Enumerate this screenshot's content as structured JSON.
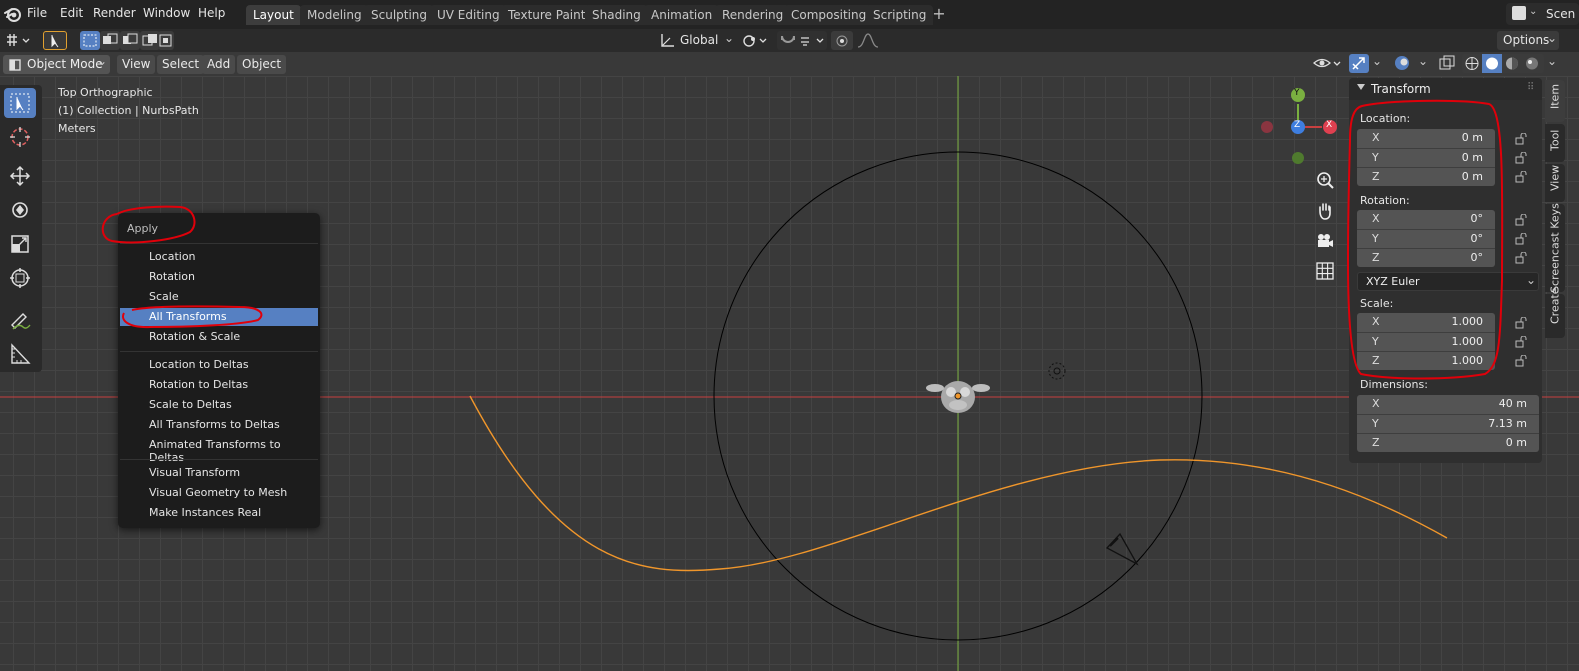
{
  "menubar": {
    "items": [
      "File",
      "Edit",
      "Render",
      "Window",
      "Help"
    ],
    "workspaces": [
      "Layout",
      "Modeling",
      "Sculpting",
      "UV Editing",
      "Texture Paint",
      "Shading",
      "Animation",
      "Rendering",
      "Compositing",
      "Scripting"
    ],
    "active_workspace": "Layout",
    "scene_label": "Scen"
  },
  "toolheader": {
    "orientation": "Global",
    "options_label": "Options"
  },
  "viewport_header": {
    "mode": "Object Mode",
    "menus": [
      "View",
      "Select",
      "Add",
      "Object"
    ]
  },
  "viewport": {
    "view_name": "Top Orthographic",
    "collection": "(1) Collection | NurbsPath",
    "units": "Meters"
  },
  "gizmo": {
    "y_label": "Y",
    "z_label": "Z",
    "x_label": "X"
  },
  "apply_menu": {
    "title": "Apply",
    "items": [
      {
        "label": "Location",
        "highlighted": false
      },
      {
        "label": "Rotation",
        "highlighted": false
      },
      {
        "label": "Scale",
        "highlighted": false
      },
      {
        "label": "All Transforms",
        "highlighted": true
      },
      {
        "label": "Rotation & Scale",
        "highlighted": false
      },
      {
        "label": "Location to Deltas",
        "highlighted": false
      },
      {
        "label": "Rotation to Deltas",
        "highlighted": false
      },
      {
        "label": "Scale to Deltas",
        "highlighted": false
      },
      {
        "label": "All Transforms to Deltas",
        "highlighted": false
      },
      {
        "label": "Animated Transforms to Deltas",
        "highlighted": false
      },
      {
        "label": "Visual Transform",
        "highlighted": false
      },
      {
        "label": "Visual Geometry to Mesh",
        "highlighted": false
      },
      {
        "label": "Make Instances Real",
        "highlighted": false
      }
    ]
  },
  "transform_panel": {
    "title": "Transform",
    "location_label": "Location:",
    "location": [
      {
        "axis": "X",
        "value": "0 m"
      },
      {
        "axis": "Y",
        "value": "0 m"
      },
      {
        "axis": "Z",
        "value": "0 m"
      }
    ],
    "rotation_label": "Rotation:",
    "rotation": [
      {
        "axis": "X",
        "value": "0°"
      },
      {
        "axis": "Y",
        "value": "0°"
      },
      {
        "axis": "Z",
        "value": "0°"
      }
    ],
    "rotation_mode": "XYZ Euler",
    "scale_label": "Scale:",
    "scale": [
      {
        "axis": "X",
        "value": "1.000"
      },
      {
        "axis": "Y",
        "value": "1.000"
      },
      {
        "axis": "Z",
        "value": "1.000"
      }
    ],
    "dimensions_label": "Dimensions:",
    "dimensions": [
      {
        "axis": "X",
        "value": "40 m"
      },
      {
        "axis": "Y",
        "value": "7.13 m"
      },
      {
        "axis": "Z",
        "value": "0 m"
      }
    ]
  },
  "sidebar_tabs": [
    "Item",
    "Tool",
    "View",
    "Screencast Keys",
    "Create"
  ],
  "colors": {
    "accent": "#5680c2",
    "annotation": "#e0000a",
    "curve": "#f0962b",
    "x_axis": "#c84040",
    "y_axis": "#7ab040"
  }
}
